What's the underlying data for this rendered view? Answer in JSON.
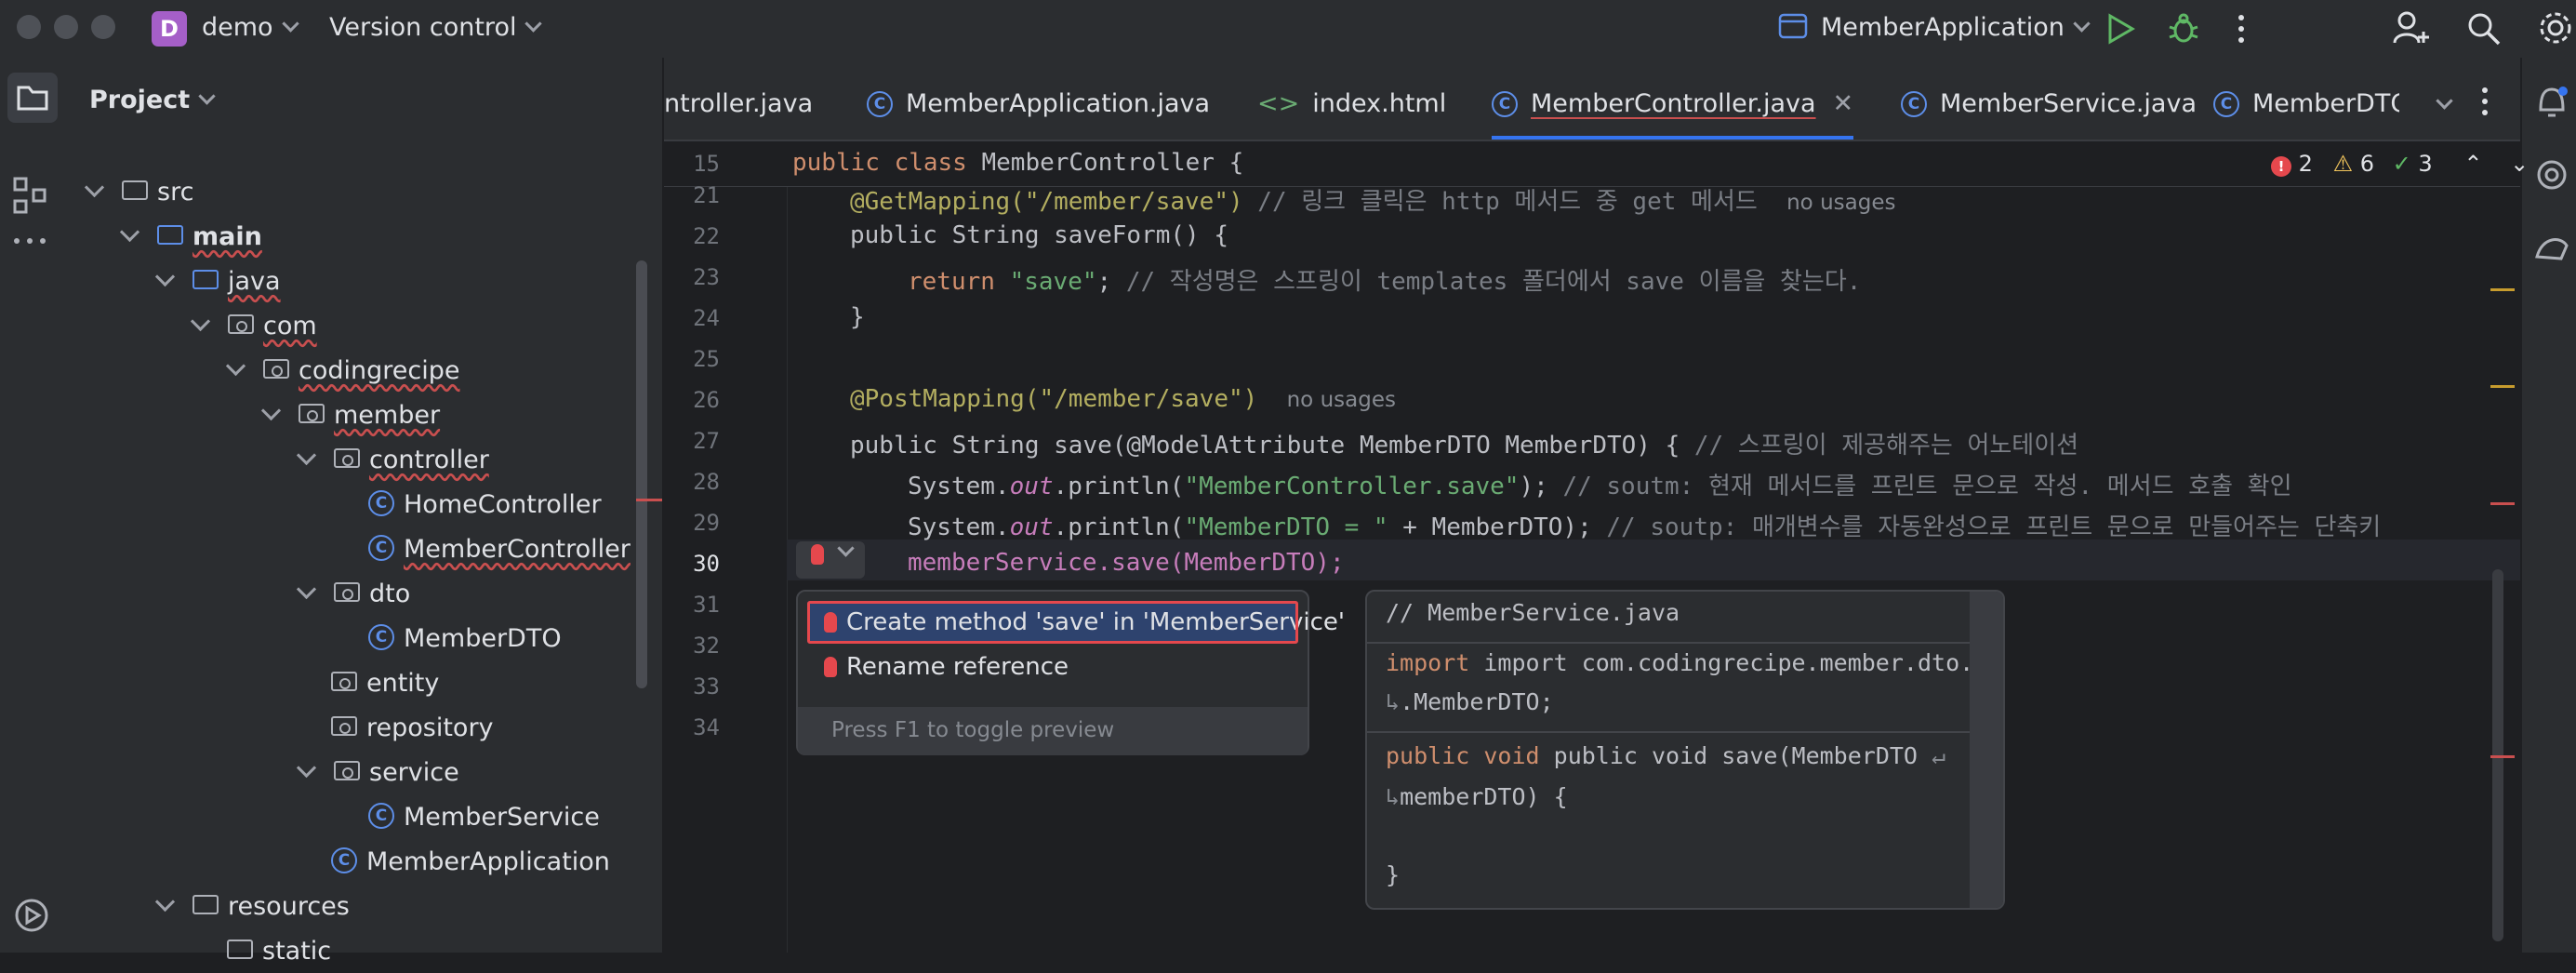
{
  "titlebar": {
    "project_badge": "D",
    "project_name": "demo",
    "vcs": "Version control",
    "run_config": "MemberApplication"
  },
  "project_panel": {
    "title": "Project",
    "tree": [
      {
        "label": "src"
      },
      {
        "label": "main"
      },
      {
        "label": "java"
      },
      {
        "label": "com"
      },
      {
        "label": "codingrecipe"
      },
      {
        "label": "member"
      },
      {
        "label": "controller"
      },
      {
        "label": "HomeController"
      },
      {
        "label": "MemberController"
      },
      {
        "label": "dto"
      },
      {
        "label": "MemberDTO"
      },
      {
        "label": "entity"
      },
      {
        "label": "repository"
      },
      {
        "label": "service"
      },
      {
        "label": "MemberService"
      },
      {
        "label": "MemberApplication"
      },
      {
        "label": "resources"
      },
      {
        "label": "static"
      }
    ]
  },
  "tabs": [
    {
      "label": "ntroller.java"
    },
    {
      "label": "MemberApplication.java"
    },
    {
      "label": "index.html"
    },
    {
      "label": "MemberController.java"
    },
    {
      "label": "MemberService.java"
    },
    {
      "label": "MemberDTO"
    }
  ],
  "inspections": {
    "errors": "2",
    "warnings": "6",
    "ok": "3"
  },
  "editor": {
    "sticky_line": "15",
    "sticky_code": "public class MemberController {",
    "line_numbers": [
      "21",
      "22",
      "23",
      "24",
      "25",
      "26",
      "27",
      "28",
      "29",
      "30",
      "31",
      "32",
      "33",
      "34"
    ],
    "hint_no_usages": "no usages",
    "lines": {
      "l21_ann": "@GetMapping(\"/member/save\")",
      "l21_cm": "// 링크 클릭은 http 메서드 중 get 메서드",
      "l22": "public String saveForm() {",
      "l23_str": "\"save\"",
      "l23_cm": "// 작성명은 스프링이 templates 폴더에서 save 이름을 찾는다.",
      "l26_ann": "@PostMapping(\"/member/save\")",
      "l27_code": "public String save(@ModelAttribute MemberDTO MemberDTO) {",
      "l27_cm": "// 스프링이 제공해주는 어노테이션",
      "l28_str": "\"MemberController.save\"",
      "l28_cm": "// soutm: 현재 메서드를 프린트 문으로 작성. 메서드 호출 확인",
      "l29_str": "\"MemberDTO = \"",
      "l29_cm": "// soutp: 매개변수를 자동완성으로 프린트 문으로 만들어주는 단축키",
      "l30": "memberService.save(MemberDTO);"
    }
  },
  "intent_popup": {
    "items": [
      {
        "label": "Create method 'save' in 'MemberService'"
      },
      {
        "label": "Rename reference"
      }
    ],
    "footer": "Press F1 to toggle preview"
  },
  "preview_popup": {
    "lines": [
      "// MemberService.java",
      "import com.codingrecipe.member.dto.",
      ".MemberDTO;",
      "public void save(MemberDTO ",
      "memberDTO) {",
      "}"
    ]
  },
  "colors": {
    "accent": "#3574f0",
    "error": "#e5484d",
    "background": "#1e1f22",
    "panel": "#2b2d30"
  }
}
